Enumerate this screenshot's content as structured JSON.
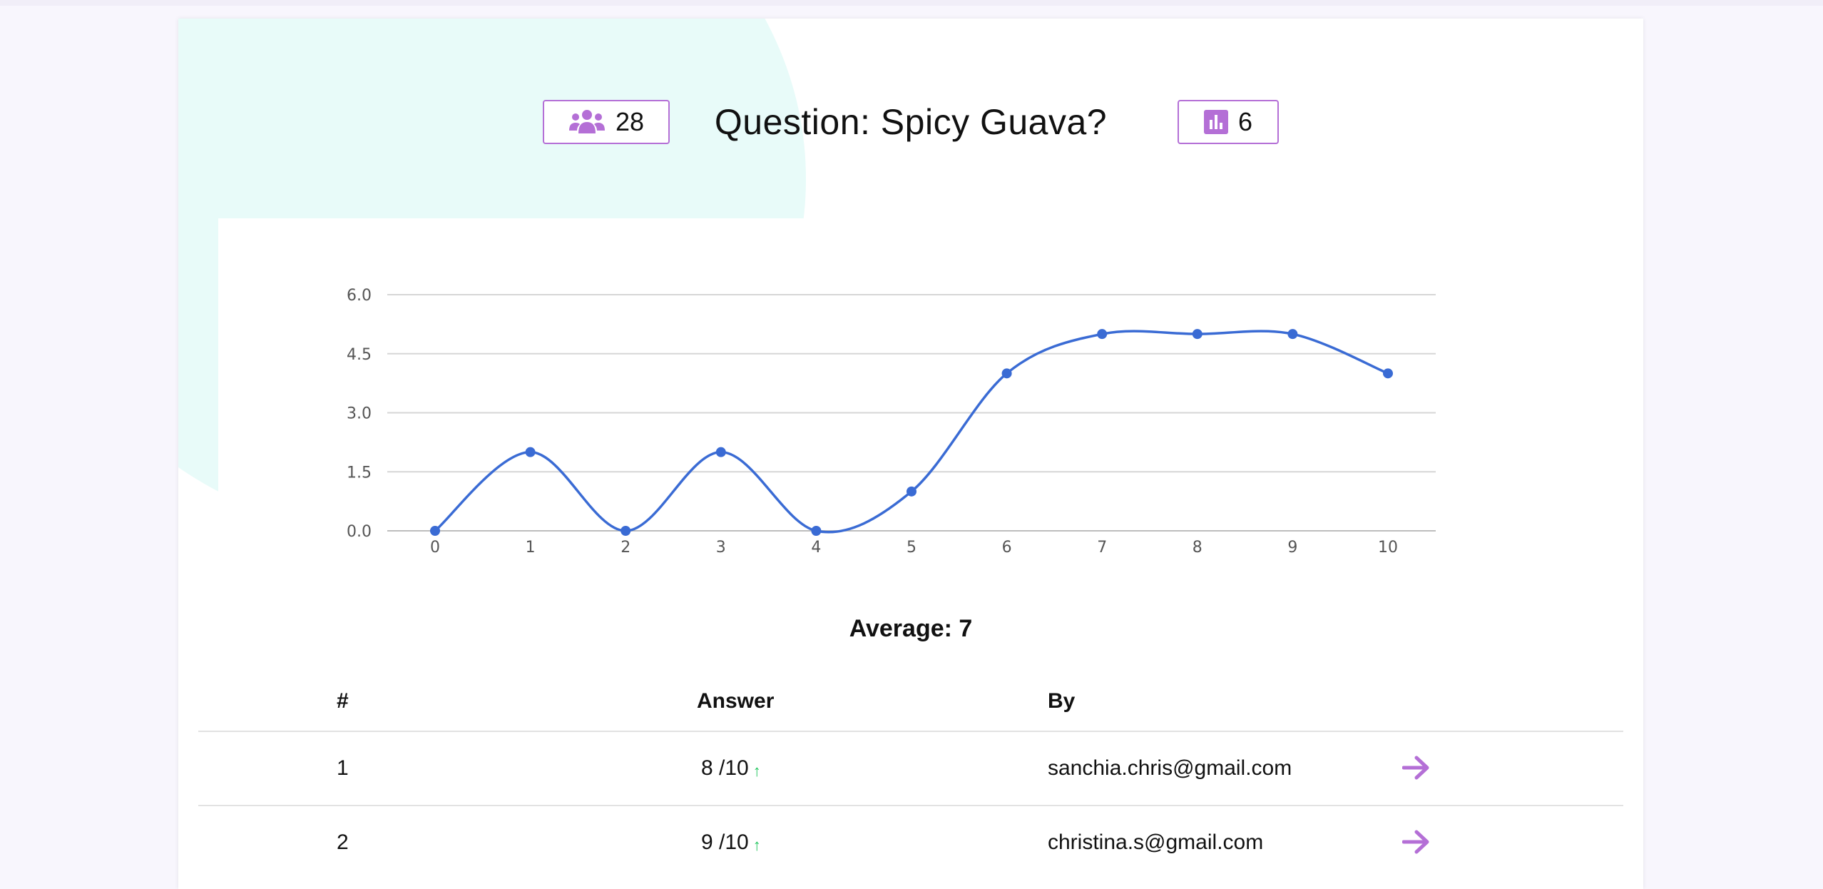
{
  "header": {
    "title": "Question: Spicy Guava?",
    "participants_count": "28",
    "participants_icon": "users-icon",
    "responses_count": "6",
    "responses_icon": "bar-chart-icon"
  },
  "chart_data": {
    "type": "line",
    "x": [
      0,
      1,
      2,
      3,
      4,
      5,
      6,
      7,
      8,
      9,
      10
    ],
    "values": [
      0,
      2,
      0,
      2,
      0,
      1,
      4,
      5,
      5,
      5,
      4
    ],
    "ylim": [
      0,
      6
    ],
    "yticks": [
      "0.0",
      "1.5",
      "3.0",
      "4.5",
      "6.0"
    ],
    "xticks": [
      "0",
      "1",
      "2",
      "3",
      "4",
      "5",
      "6",
      "7",
      "8",
      "9",
      "10"
    ],
    "grid": true,
    "line_color": "#3a6bd4"
  },
  "summary": {
    "average": "Average: 7"
  },
  "table": {
    "columns": [
      "#",
      "Answer",
      "By"
    ],
    "rows": [
      {
        "index": "1",
        "answer": "8 /10",
        "by": "sanchia.chris@gmail.com"
      },
      {
        "index": "2",
        "answer": "9 /10",
        "by": "christina.s@gmail.com"
      }
    ]
  },
  "colors": {
    "accent": "#b46fd6",
    "up": "#22c55e",
    "blob": "#e8fbf9"
  }
}
